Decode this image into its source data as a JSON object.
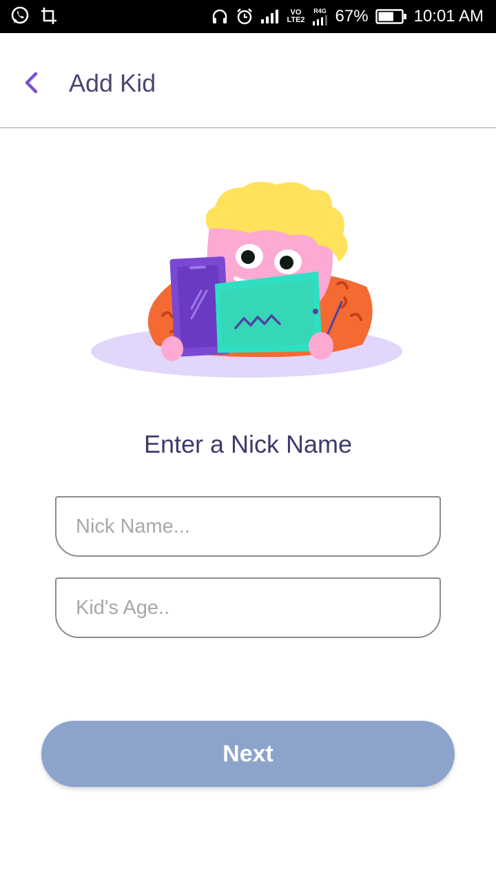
{
  "status_bar": {
    "left_icons": [
      "whatsapp-icon",
      "crop-icon"
    ],
    "right_icons": [
      "headset-icon",
      "alarm-icon",
      "signal-icon",
      "volte-badge",
      "r4g-signal-icon",
      "battery-icon"
    ],
    "volte_top": "VO",
    "volte_bottom": "LTE2",
    "r4g_label": "R4G",
    "battery_percent": "67%",
    "battery_level": 0.67,
    "time": "10:01 AM"
  },
  "app_bar": {
    "title": "Add Kid",
    "back_icon": "chevron-left-icon",
    "accent_color": "#7b4fd4"
  },
  "illustration": {
    "name": "kid-with-tablets-illustration"
  },
  "form": {
    "heading": "Enter a Nick Name",
    "nick_name": {
      "value": "",
      "placeholder": "Nick Name..."
    },
    "kid_age": {
      "value": "",
      "placeholder": "Kid's Age.."
    }
  },
  "actions": {
    "next_label": "Next",
    "next_color": "#8ca4cc"
  }
}
